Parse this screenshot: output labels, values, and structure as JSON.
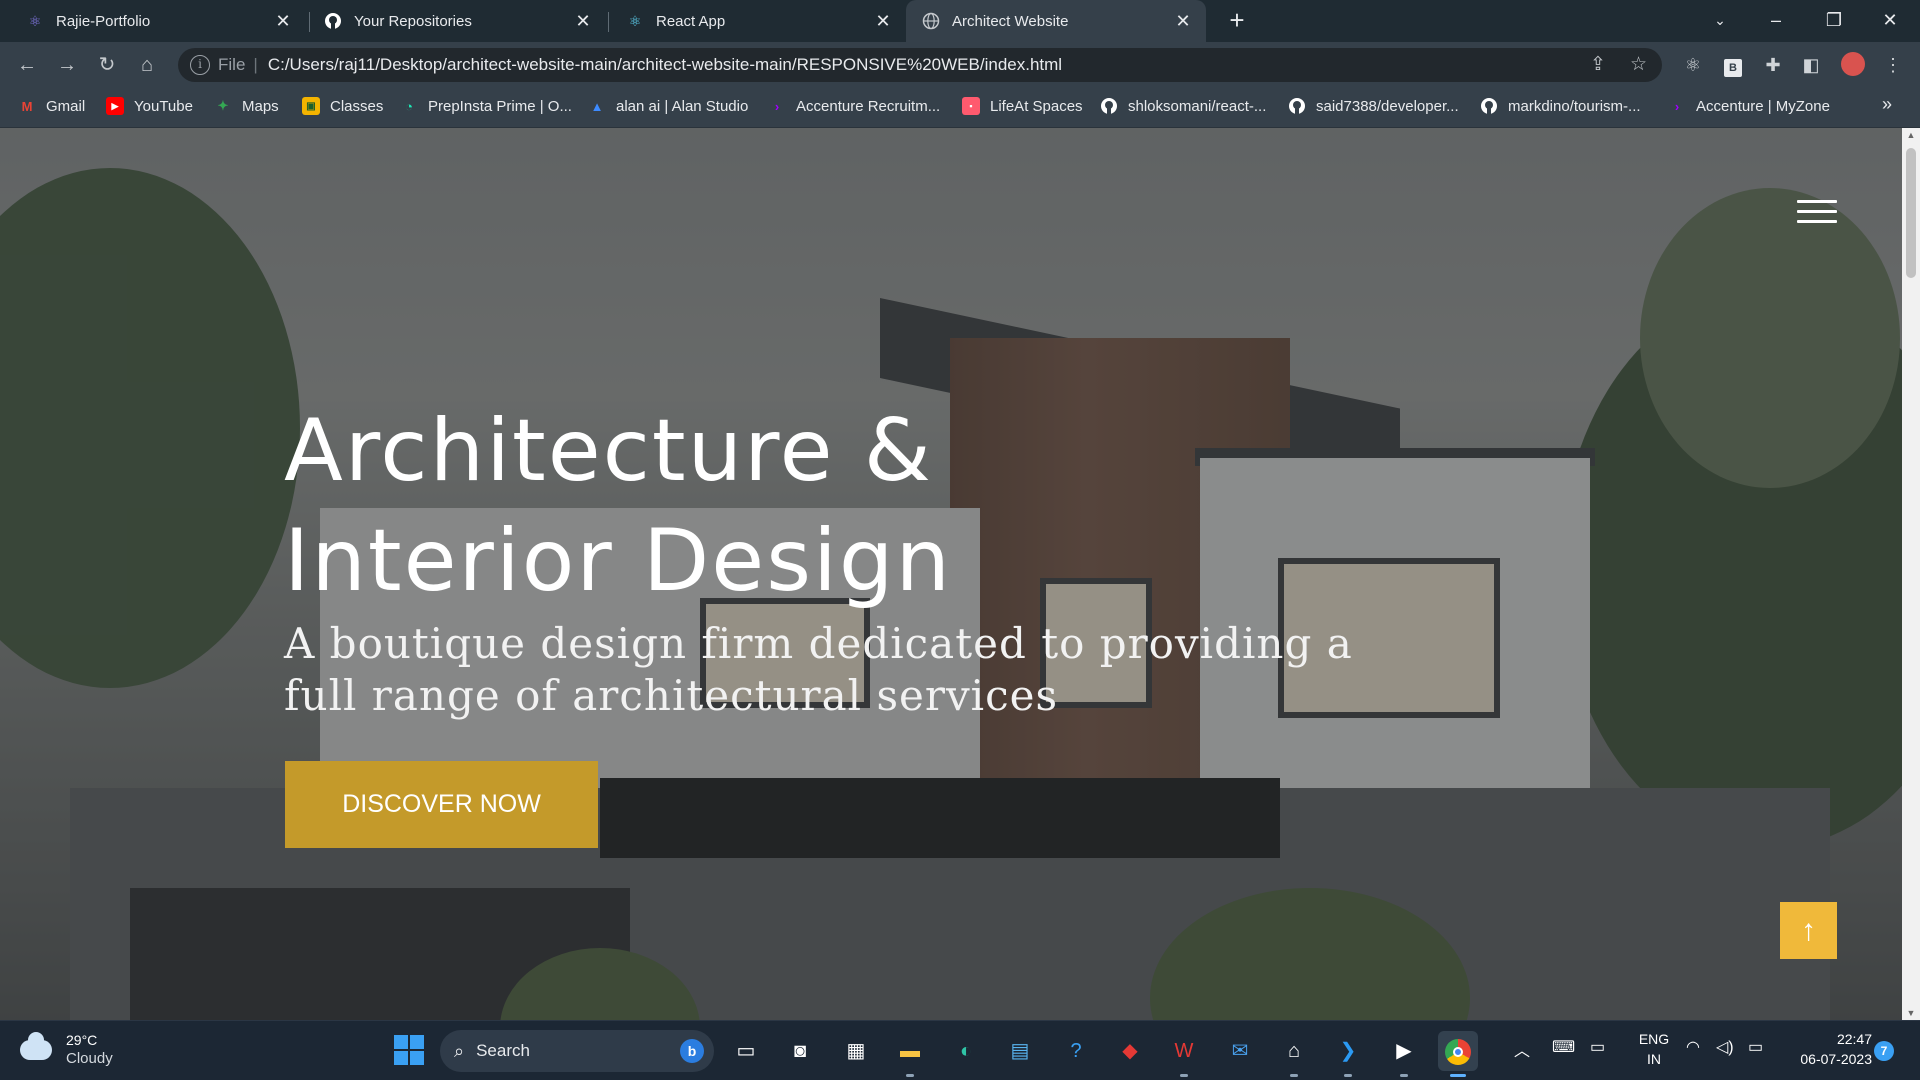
{
  "browser": {
    "tabs": [
      {
        "title": "Rajie-Portfolio",
        "icon": "react-icon",
        "active": false
      },
      {
        "title": "Your Repositories",
        "icon": "github-icon",
        "active": false
      },
      {
        "title": "React App",
        "icon": "react-icon",
        "active": false
      },
      {
        "title": "Architect Website",
        "icon": "globe-icon",
        "active": true
      }
    ],
    "new_tab": "+",
    "address": {
      "scheme_label": "File",
      "url": "C:/Users/raj11/Desktop/architect-website-main/architect-website-main/RESPONSIVE%20WEB/index.html"
    },
    "bookmarks": [
      {
        "label": "Gmail",
        "icon": "gmail-icon",
        "color": "#ea4335"
      },
      {
        "label": "YouTube",
        "icon": "youtube-icon",
        "color": "#ff0000"
      },
      {
        "label": "Maps",
        "icon": "maps-icon",
        "color": "#34a853"
      },
      {
        "label": "Classes",
        "icon": "classroom-icon",
        "color": "#f4b400"
      },
      {
        "label": "PrepInsta Prime | O...",
        "icon": "prepinsta-icon",
        "color": "#1de9b6"
      },
      {
        "label": "alan ai | Alan Studio",
        "icon": "alan-icon",
        "color": "#3d8bff"
      },
      {
        "label": "Accenture Recruitm...",
        "icon": "accenture-icon",
        "color": "#a100ff"
      },
      {
        "label": "LifeAt Spaces",
        "icon": "lifeat-icon",
        "color": "#ff5a6e"
      },
      {
        "label": "shloksomani/react-...",
        "icon": "github-icon",
        "color": "#ffffff"
      },
      {
        "label": "said7388/developer...",
        "icon": "github-icon",
        "color": "#ffffff"
      },
      {
        "label": "markdino/tourism-...",
        "icon": "github-icon",
        "color": "#ffffff"
      },
      {
        "label": "Accenture | MyZone",
        "icon": "accenture-icon",
        "color": "#a100ff"
      }
    ],
    "bookmarks_more": "»"
  },
  "page": {
    "hero_title_line1": "Architecture &",
    "hero_title_line2": "Interior Design",
    "hero_subtitle_line1": "A boutique design firm dedicated to providing a",
    "hero_subtitle_line2": "full range of architectural services",
    "cta_label": "DISCOVER NOW",
    "accent_color": "#c49a2a",
    "scroll_top_color": "#f0b93a"
  },
  "taskbar": {
    "weather_temp": "29°C",
    "weather_condition": "Cloudy",
    "search_label": "Search",
    "lang_line1": "ENG",
    "lang_line2": "IN",
    "time": "22:47",
    "date": "06-07-2023",
    "notification_count": "7"
  }
}
